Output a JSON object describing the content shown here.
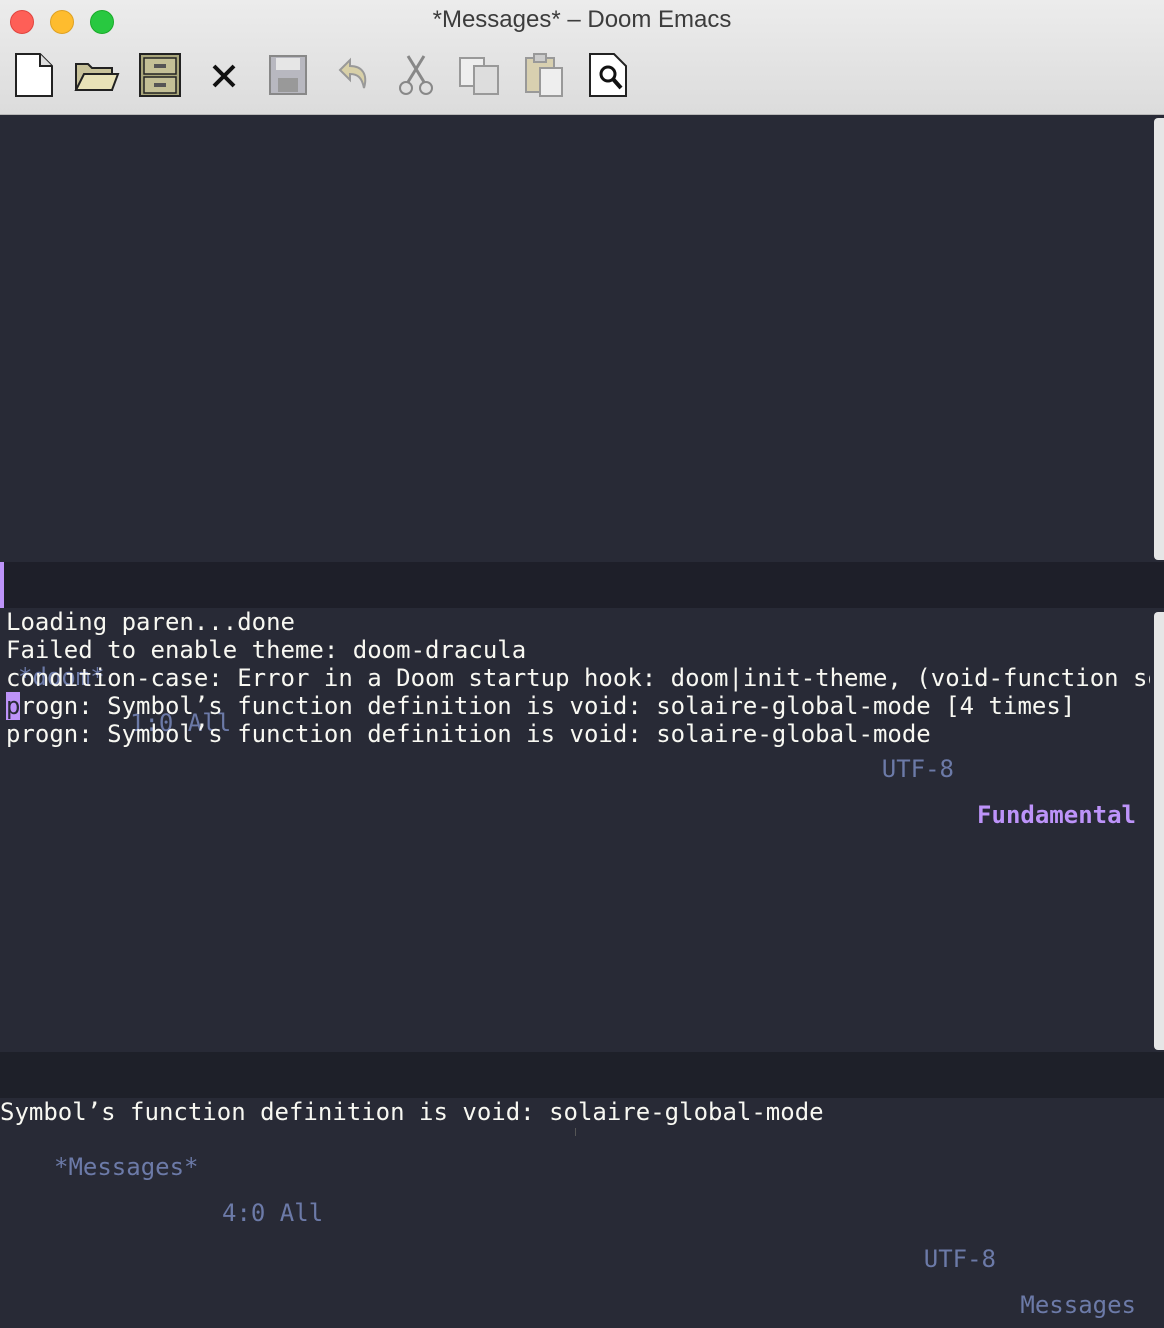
{
  "window": {
    "title": "*Messages* – Doom Emacs"
  },
  "toolbar": {
    "tools": [
      "new-file-icon",
      "open-folder-icon",
      "file-cabinet-icon",
      "close-x-icon",
      "save-icon",
      "undo-icon",
      "cut-icon",
      "copy-icon",
      "paste-icon",
      "search-icon"
    ]
  },
  "top_modeline": {
    "buffer": "*doom*",
    "position": "1:0 All",
    "encoding": "UTF-8",
    "mode": "Fundamental"
  },
  "messages": {
    "lines": [
      "Loading paren...done",
      "Failed to enable theme: doom-dracula",
      "condition-case: Error in a Doom startup hook: doom|init-theme, (void-function sol",
      "rogn: Symbol’s function definition is void: solaire-global-mode [4 times]",
      "progn: Symbol’s function definition is void: solaire-global-mode"
    ],
    "cursor_char": "p"
  },
  "bottom_modeline": {
    "buffer": "*Messages*",
    "position": "4:0 All",
    "encoding": "UTF-8",
    "mode": "Messages"
  },
  "minibuffer": {
    "text": "Symbol’s function definition is void: solaire-global-mode"
  },
  "colors": {
    "background": "#282a36",
    "accent": "#bd93f9",
    "modeline": "#1e1f29",
    "muted": "#6272a4"
  }
}
